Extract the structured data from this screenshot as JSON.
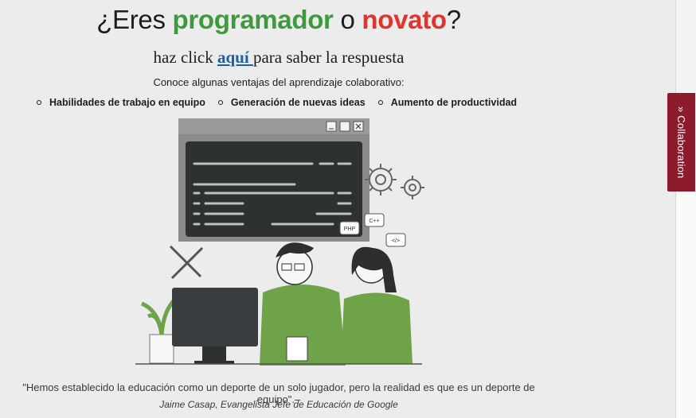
{
  "header": {
    "prefix": "¿Eres ",
    "word1": "programador",
    "mid": " o ",
    "word2": "novato",
    "suffix": "?"
  },
  "subtitle": {
    "before": "haz click ",
    "link": "aquí ",
    "after": "para saber la respuesta"
  },
  "intro": "Conoce algunas ventajas del aprendizaje colaborativo:",
  "benefits": [
    "Habilidades de trabajo en equipo",
    "Generación de nuevas ideas",
    "Aumento de productividad"
  ],
  "illustration": {
    "labels": {
      "cpp": "C++",
      "php": "PHP",
      "code": "</>"
    }
  },
  "quote": {
    "text": "\"Hemos establecido la educación como un deporte de un solo jugador, pero la realidad es que es un deporte de equipo\".–",
    "author": "Jaime Casap, Evangelista Jefe de Educación de Google"
  },
  "sidebar_tab": {
    "label": "Collaboration",
    "icon": "double-chevron-icon"
  },
  "colors": {
    "green": "#3f9a3f",
    "red": "#e1342b",
    "link": "#1f5fa3",
    "tab": "#8e1b2b"
  }
}
